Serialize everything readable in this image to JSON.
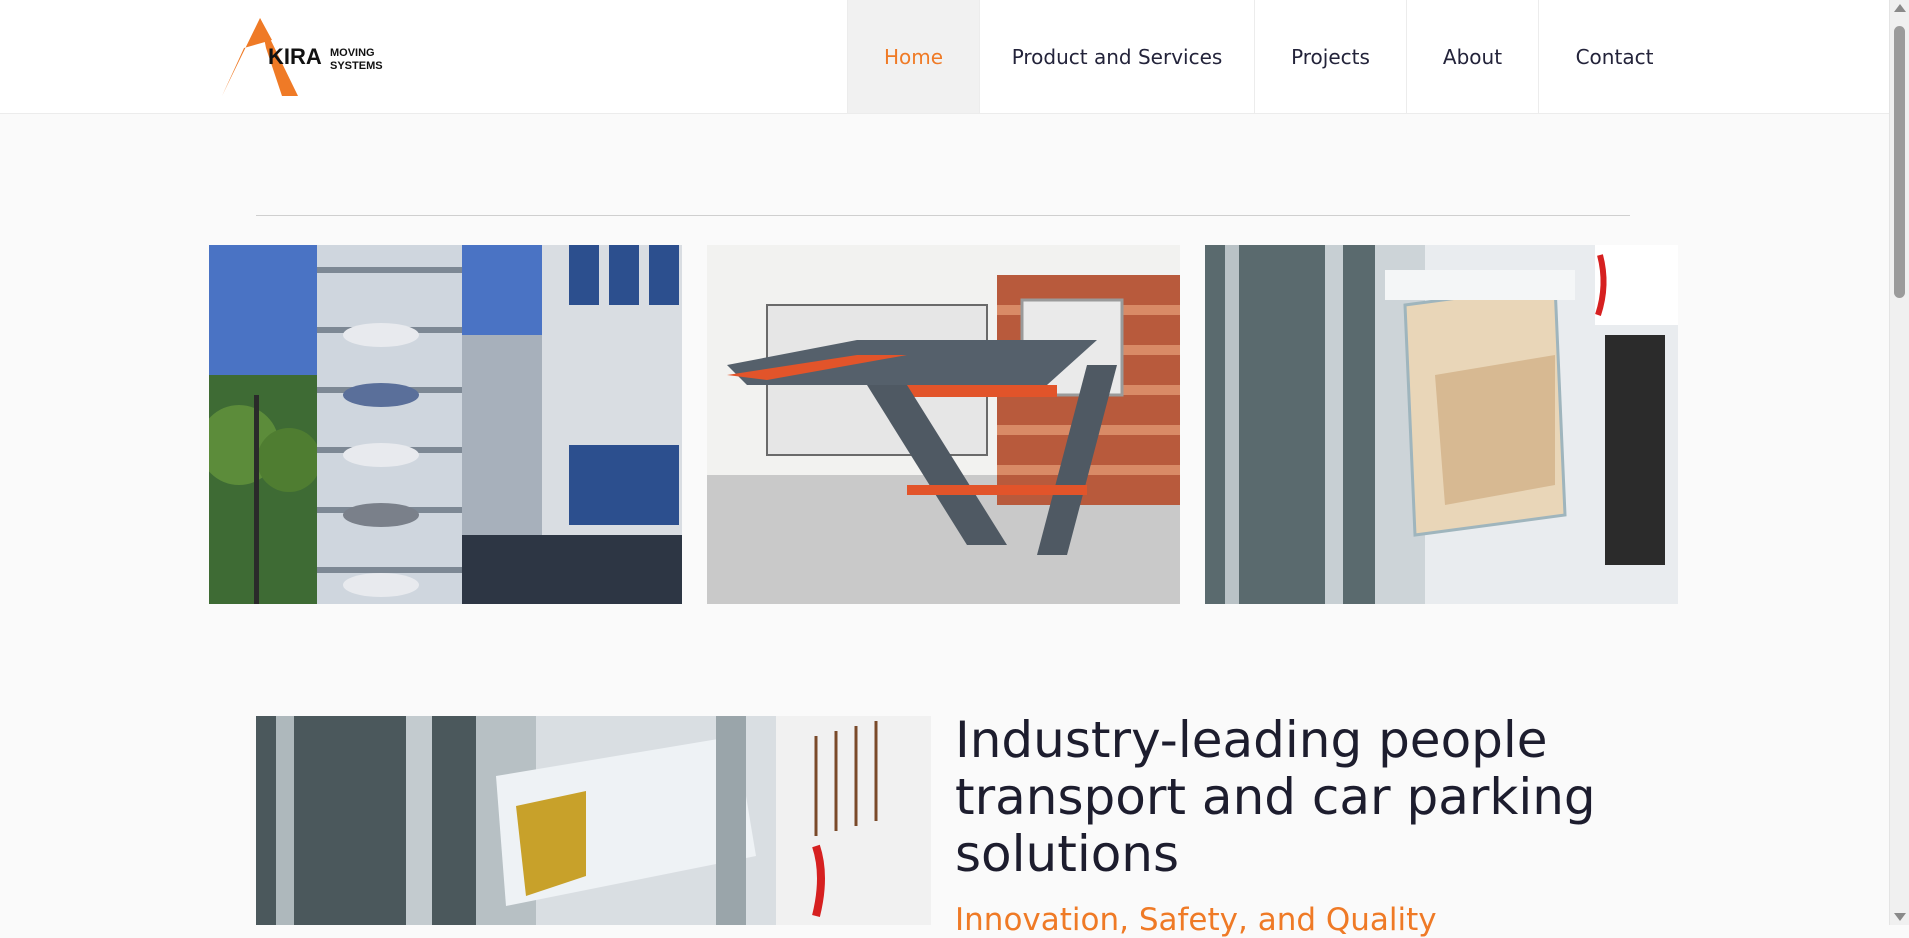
{
  "brand": {
    "logo_word": "KIRA",
    "logo_sub_line1": "MOVING",
    "logo_sub_line2": "SYSTEMS",
    "accent_color": "#ef7a26"
  },
  "nav": {
    "items": [
      {
        "label": "Home",
        "active": true
      },
      {
        "label": "Product and Services",
        "active": false
      },
      {
        "label": "Projects",
        "active": false
      },
      {
        "label": "About",
        "active": false
      },
      {
        "label": "Contact",
        "active": false
      }
    ]
  },
  "gallery": [
    {
      "icon": "car-parking-tower-photo"
    },
    {
      "icon": "car-lift-platform-photo"
    },
    {
      "icon": "glass-elevator-photo"
    }
  ],
  "feature": {
    "image_icon": "elevator-shaft-photo",
    "headline": "Industry-leading people transport and car parking solutions",
    "tagline": "Innovation, Safety, and Quality"
  }
}
